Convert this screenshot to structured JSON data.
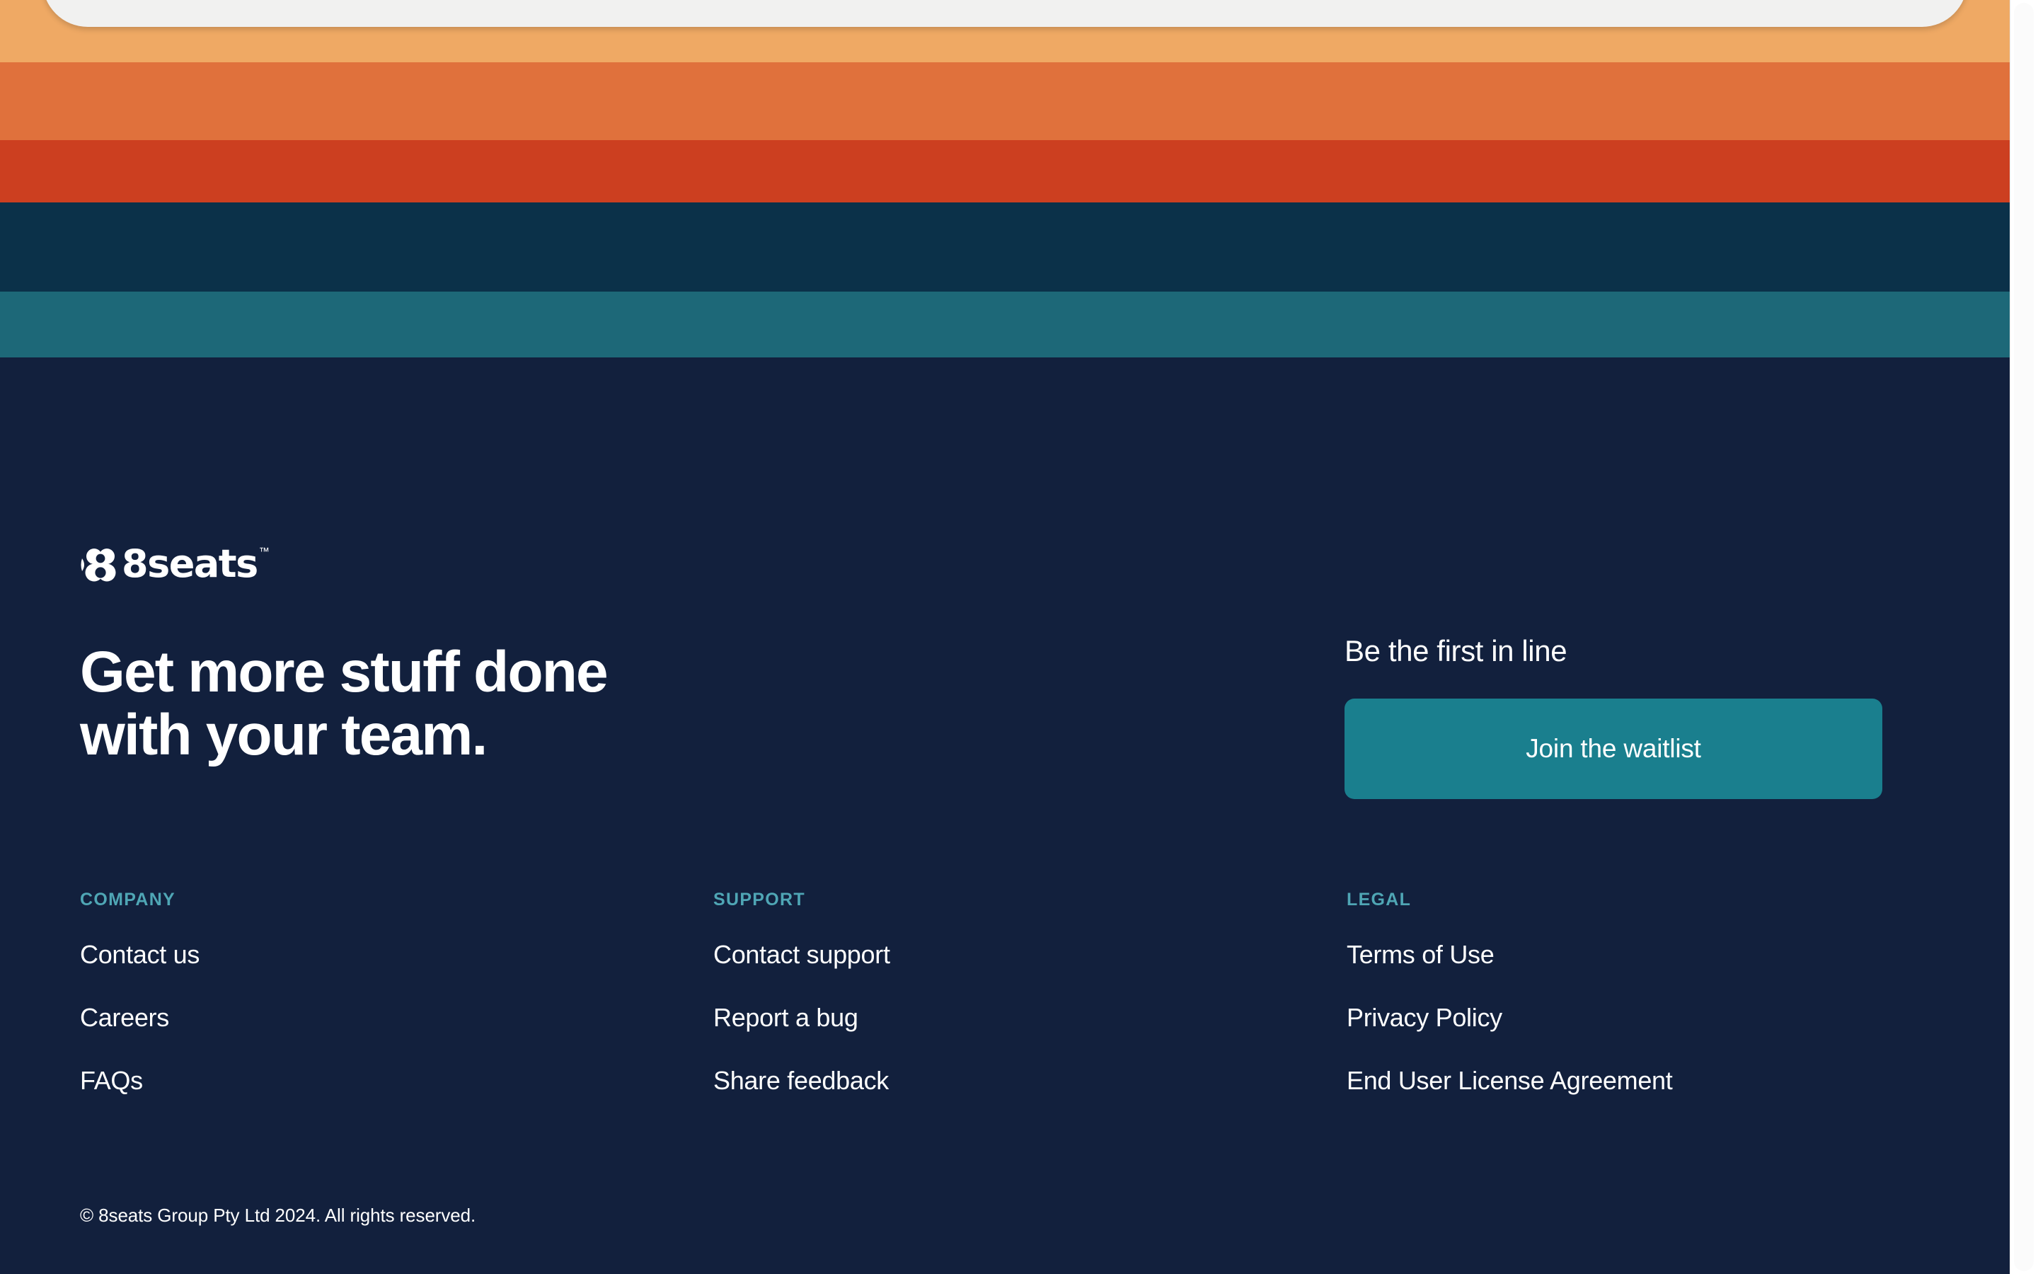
{
  "brand": {
    "logo_word": "8seats",
    "logo_trademark": "™",
    "logo_icon_name": "8seats-logo-mark"
  },
  "decor": {
    "stripes": [
      {
        "name": "peach",
        "color": "#efa964"
      },
      {
        "name": "orange",
        "color": "#e0713c"
      },
      {
        "name": "red",
        "color": "#cc3f20"
      },
      {
        "name": "navy",
        "color": "#0b3149"
      },
      {
        "name": "teal-dark",
        "color": "#1d6878"
      },
      {
        "name": "teal-bright",
        "color": "#319ead"
      },
      {
        "name": "green",
        "color": "#7ab9a8"
      },
      {
        "name": "cream",
        "color": "#ebd2ae"
      }
    ],
    "panel_color": "#f1f1f0"
  },
  "footer": {
    "background": "#12203d",
    "headline": "Get more stuff done\nwith your team.",
    "cta": {
      "title": "Be the first in line",
      "button_label": "Join the waitlist",
      "button_color": "#1a7f8e"
    },
    "heading_color": "#4fa6b5",
    "columns": [
      {
        "heading": "COMPANY",
        "links": [
          "Contact us",
          "Careers",
          "FAQs"
        ]
      },
      {
        "heading": "SUPPORT",
        "links": [
          "Contact support",
          "Report a bug",
          "Share feedback"
        ]
      },
      {
        "heading": "LEGAL",
        "links": [
          "Terms of Use",
          "Privacy Policy",
          "End User License Agreement"
        ]
      }
    ],
    "copyright": "© 8seats Group Pty Ltd 2024. All rights reserved."
  }
}
